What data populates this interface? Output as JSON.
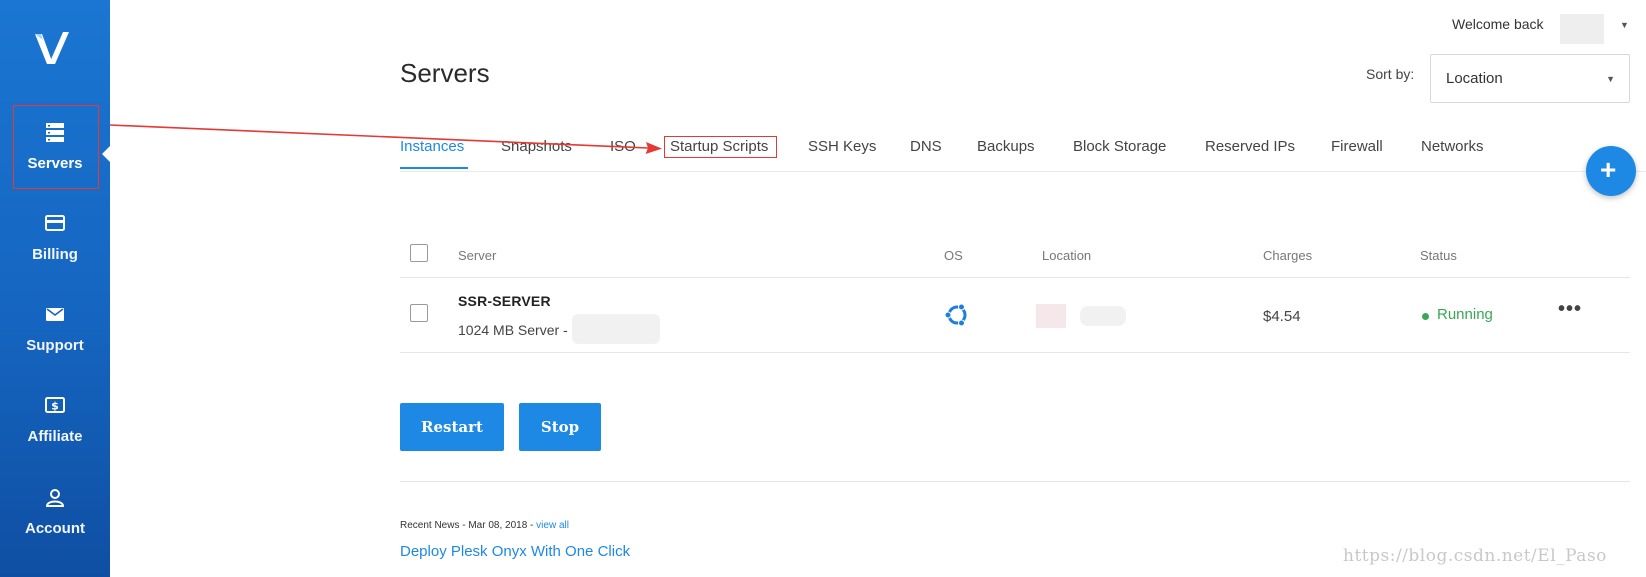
{
  "sidebar": {
    "items": [
      {
        "key": "servers",
        "label": "Servers",
        "icon": "servers-icon",
        "active": true
      },
      {
        "key": "billing",
        "label": "Billing",
        "icon": "credit-card-icon",
        "active": false
      },
      {
        "key": "support",
        "label": "Support",
        "icon": "envelope-icon",
        "active": false
      },
      {
        "key": "affiliate",
        "label": "Affiliate",
        "icon": "dollar-icon",
        "active": false
      },
      {
        "key": "account",
        "label": "Account",
        "icon": "user-icon",
        "active": false
      }
    ]
  },
  "header": {
    "welcome": "Welcome back",
    "title": "Servers",
    "sort_label": "Sort by:",
    "sort_value": "Location"
  },
  "tabs": [
    {
      "label": "Instances",
      "active": true
    },
    {
      "label": "Snapshots",
      "active": false
    },
    {
      "label": "ISO",
      "active": false
    },
    {
      "label": "Startup Scripts",
      "active": false,
      "highlighted": true
    },
    {
      "label": "SSH Keys",
      "active": false
    },
    {
      "label": "DNS",
      "active": false
    },
    {
      "label": "Backups",
      "active": false
    },
    {
      "label": "Block Storage",
      "active": false
    },
    {
      "label": "Reserved IPs",
      "active": false
    },
    {
      "label": "Firewall",
      "active": false
    },
    {
      "label": "Networks",
      "active": false
    }
  ],
  "fab": {
    "icon": "plus-icon",
    "label": "+"
  },
  "table": {
    "columns": [
      "Server",
      "OS",
      "Location",
      "Charges",
      "Status"
    ],
    "rows": [
      {
        "name": "SSR-SERVER",
        "description": "1024 MB Server -",
        "os": "ubuntu-icon",
        "charges": "$4.54",
        "status": "Running"
      }
    ]
  },
  "actions": {
    "restart": "Restart",
    "stop": "Stop"
  },
  "news": {
    "meta": "Recent News - Mar 08, 2018 - ",
    "view_all": "view all",
    "title": "Deploy Plesk Onyx With One Click"
  },
  "watermark": "https://blog.csdn.net/El_Paso",
  "colors": {
    "accent": "#1e88e5",
    "sidebar": "#1565c0",
    "status_running": "#3aa757",
    "annotation": "#e53935"
  }
}
